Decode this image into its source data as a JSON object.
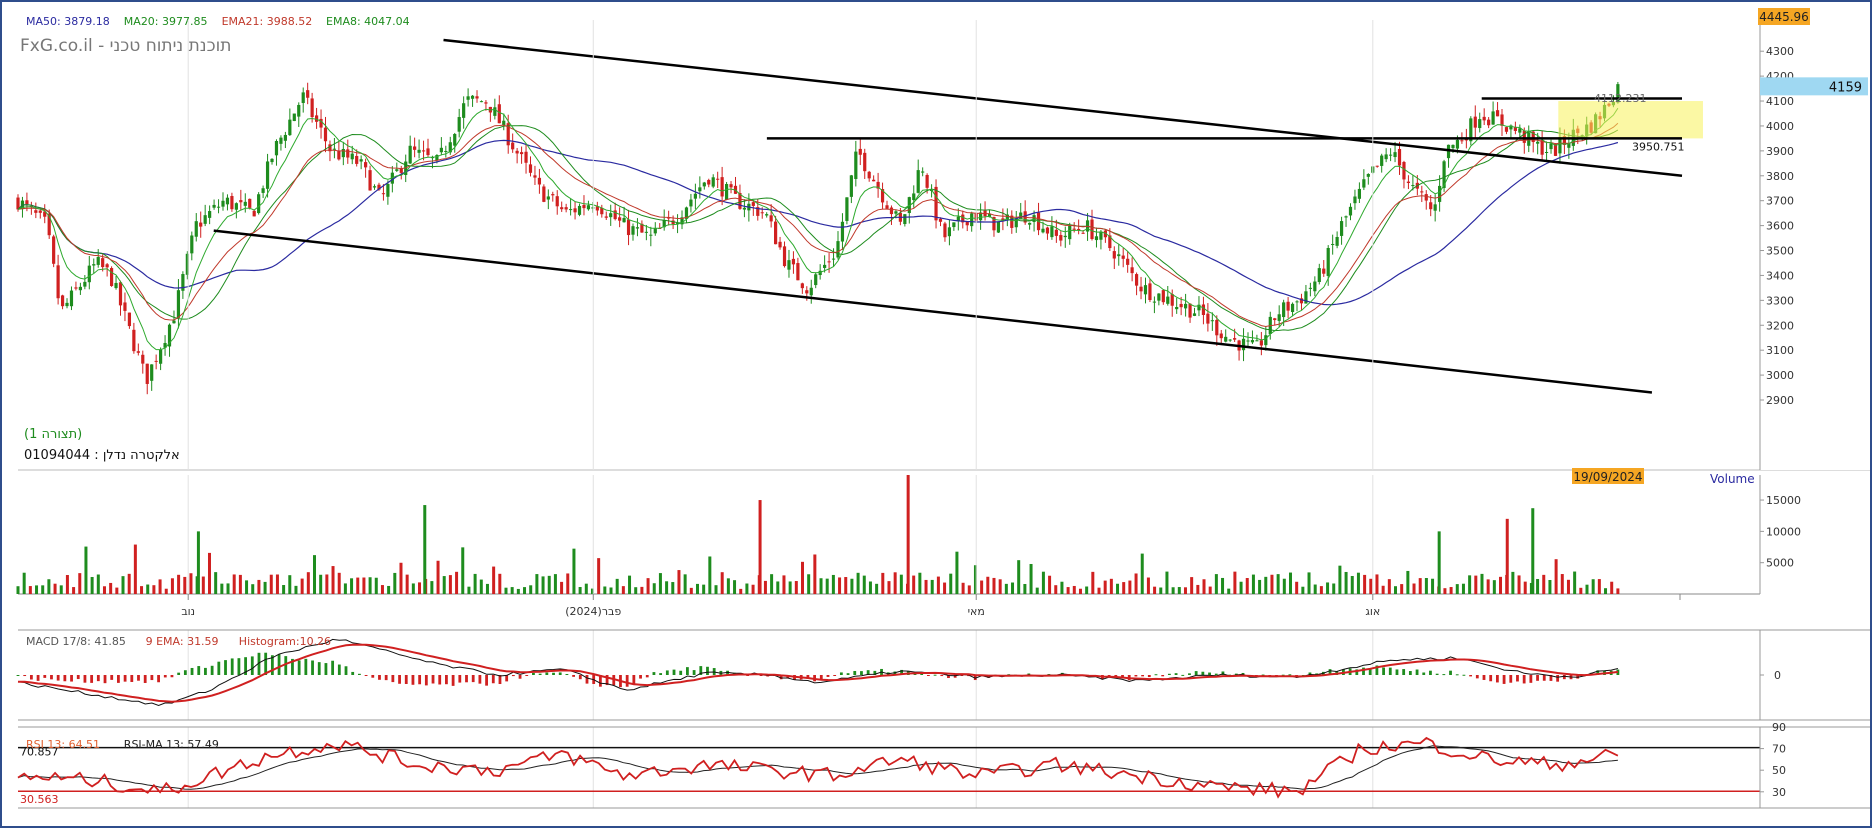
{
  "chart_data": [
    {
      "type": "candlestick",
      "watermark": "FxG.co.il - תוכנת ניתוח טכני",
      "instrument": "אלקטרה נדלן : 01094044",
      "view_label": "(תצורה 1)",
      "date_badge": "19/09/2024",
      "indicators": [
        {
          "text": "MA50: 3879.18",
          "color": "#2a2aa0"
        },
        {
          "text": "MA20: 3977.85",
          "color": "#1e8c1e"
        },
        {
          "text": "EMA21: 3988.52",
          "color": "#c0392b"
        },
        {
          "text": "EMA8: 4047.04",
          "color": "#1e8c1e"
        }
      ],
      "top_price_badge": "4445.96",
      "last_price_badge": "4159",
      "annotations": [
        "4112.231",
        "3950.751"
      ],
      "y_ticks": [
        "4300",
        "4200",
        "4100",
        "4000",
        "3900",
        "3800",
        "3700",
        "3600",
        "3500",
        "3400",
        "3300",
        "3200",
        "3100",
        "3000",
        "2900"
      ],
      "ylim": [
        2900,
        4345
      ],
      "x_ticks": [
        {
          "label": "נוב",
          "pos": 0.1
        },
        {
          "label": "פבר(2024)",
          "pos": 0.338
        },
        {
          "label": "מאי",
          "pos": 0.563
        },
        {
          "label": "אוג",
          "pos": 0.796
        }
      ],
      "close_profile": [
        [
          0,
          3700
        ],
        [
          0.02,
          3600
        ],
        [
          0.03,
          3250
        ],
        [
          0.055,
          3450
        ],
        [
          0.065,
          3400
        ],
        [
          0.08,
          3150
        ],
        [
          0.09,
          2980
        ],
        [
          0.11,
          3250
        ],
        [
          0.125,
          3600
        ],
        [
          0.145,
          3700
        ],
        [
          0.165,
          3650
        ],
        [
          0.18,
          3900
        ],
        [
          0.2,
          4120
        ],
        [
          0.22,
          3900
        ],
        [
          0.24,
          3850
        ],
        [
          0.255,
          3700
        ],
        [
          0.275,
          3900
        ],
        [
          0.295,
          3850
        ],
        [
          0.315,
          4100
        ],
        [
          0.33,
          4100
        ],
        [
          0.345,
          3950
        ],
        [
          0.365,
          3750
        ],
        [
          0.385,
          3650
        ],
        [
          0.405,
          3700
        ],
        [
          0.425,
          3600
        ],
        [
          0.445,
          3550
        ],
        [
          0.465,
          3650
        ],
        [
          0.485,
          3800
        ],
        [
          0.505,
          3700
        ],
        [
          0.525,
          3650
        ],
        [
          0.54,
          3450
        ],
        [
          0.555,
          3350
        ],
        [
          0.575,
          3500
        ],
        [
          0.59,
          3900
        ],
        [
          0.605,
          3750
        ],
        [
          0.62,
          3600
        ],
        [
          0.635,
          3850
        ],
        [
          0.65,
          3550
        ],
        [
          0.67,
          3650
        ],
        [
          0.69,
          3600
        ],
        [
          0.71,
          3650
        ],
        [
          0.73,
          3550
        ],
        [
          0.75,
          3600
        ],
        [
          0.77,
          3500
        ],
        [
          0.79,
          3350
        ],
        [
          0.81,
          3300
        ],
        [
          0.83,
          3250
        ],
        [
          0.85,
          3150
        ],
        [
          0.87,
          3100
        ],
        [
          0.885,
          3250
        ],
        [
          0.9,
          3300
        ],
        [
          0.915,
          3400
        ],
        [
          0.93,
          3600
        ],
        [
          0.95,
          3800
        ],
        [
          0.965,
          3900
        ],
        [
          0.98,
          3750
        ],
        [
          0.995,
          3650
        ]
      ],
      "recent_profile": [
        [
          0,
          3650
        ],
        [
          0.06,
          3900
        ],
        [
          0.15,
          3950
        ],
        [
          0.25,
          4050
        ],
        [
          0.35,
          4020
        ],
        [
          0.45,
          3980
        ],
        [
          0.55,
          3920
        ],
        [
          0.65,
          3900
        ],
        [
          0.75,
          3960
        ],
        [
          0.85,
          4000
        ],
        [
          0.92,
          4060
        ],
        [
          1.0,
          4159
        ]
      ],
      "trend_lines": [
        {
          "from": [
            0.25,
            4345
          ],
          "to": [
            0.99,
            3800
          ]
        },
        {
          "from": [
            0.115,
            3580
          ],
          "to": [
            0.96,
            2930
          ]
        },
        {
          "from": [
            0.44,
            3950
          ],
          "to": [
            1.08,
            3950
          ]
        },
        {
          "from": [
            0.86,
            4110
          ],
          "to": [
            1.0,
            4110
          ]
        }
      ],
      "highlight_range": [
        4100,
        3950
      ]
    },
    {
      "type": "bar",
      "label": "Volume",
      "y_ticks": [
        "15000",
        "10000",
        "5000"
      ],
      "ylim": [
        0,
        19000
      ],
      "spikes": [
        {
          "pos": 0.106,
          "value": 10000,
          "color": "#1e8c1e"
        },
        {
          "pos": 0.239,
          "value": 14200,
          "color": "#1e8c1e"
        },
        {
          "pos": 0.436,
          "value": 15000,
          "color": "#d02020"
        },
        {
          "pos": 0.523,
          "value": 19000,
          "color": "#d02020"
        },
        {
          "pos": 0.835,
          "value": 10000,
          "color": "#1e8c1e"
        },
        {
          "pos": 0.875,
          "value": 12000,
          "color": "#d02020"
        },
        {
          "pos": 0.89,
          "value": 13700,
          "color": "#1e8c1e"
        }
      ]
    },
    {
      "type": "histogram",
      "indicators": [
        {
          "text": "MACD 17/8: 41.85",
          "color": "#555555"
        },
        {
          "text": "9 EMA: 31.59",
          "color": "#c0392b"
        },
        {
          "text": "Histogram:10.26",
          "color": "#c0392b"
        }
      ],
      "y_ticks": [
        "0"
      ],
      "macd_profile": [
        [
          0,
          -20
        ],
        [
          0.06,
          -60
        ],
        [
          0.09,
          -80
        ],
        [
          0.12,
          -40
        ],
        [
          0.16,
          50
        ],
        [
          0.2,
          95
        ],
        [
          0.26,
          30
        ],
        [
          0.3,
          0
        ],
        [
          0.34,
          15
        ],
        [
          0.38,
          -40
        ],
        [
          0.43,
          5
        ],
        [
          0.47,
          0
        ],
        [
          0.5,
          -20
        ],
        [
          0.55,
          10
        ],
        [
          0.6,
          -5
        ],
        [
          0.65,
          0
        ],
        [
          0.7,
          -15
        ],
        [
          0.75,
          0
        ],
        [
          0.8,
          -5
        ],
        [
          0.86,
          40
        ],
        [
          0.9,
          45
        ],
        [
          0.94,
          5
        ],
        [
          0.97,
          -5
        ],
        [
          1.0,
          15
        ]
      ]
    },
    {
      "type": "line",
      "indicators": [
        {
          "text": "RSI 13: 64.51",
          "color": "#e06030"
        },
        {
          "text": "RSI-MA 13: 57.49",
          "color": "#222222"
        }
      ],
      "y_ticks": [
        "90",
        "70",
        "50",
        "30"
      ],
      "ylim": [
        15,
        90
      ],
      "levels": [
        {
          "value": 70.857,
          "label": "70.857",
          "color": "#111111"
        },
        {
          "value": 30.563,
          "label": "30.563",
          "color": "#d02020"
        }
      ],
      "rsi_profile": [
        [
          0,
          45
        ],
        [
          0.05,
          40
        ],
        [
          0.09,
          30
        ],
        [
          0.12,
          45
        ],
        [
          0.16,
          65
        ],
        [
          0.2,
          75
        ],
        [
          0.25,
          55
        ],
        [
          0.3,
          50
        ],
        [
          0.34,
          65
        ],
        [
          0.38,
          45
        ],
        [
          0.43,
          55
        ],
        [
          0.47,
          50
        ],
        [
          0.51,
          45
        ],
        [
          0.55,
          60
        ],
        [
          0.6,
          45
        ],
        [
          0.65,
          55
        ],
        [
          0.7,
          45
        ],
        [
          0.75,
          35
        ],
        [
          0.8,
          30
        ],
        [
          0.84,
          70
        ],
        [
          0.88,
          75
        ],
        [
          0.92,
          60
        ],
        [
          0.96,
          55
        ],
        [
          1.0,
          64.5
        ]
      ]
    }
  ]
}
